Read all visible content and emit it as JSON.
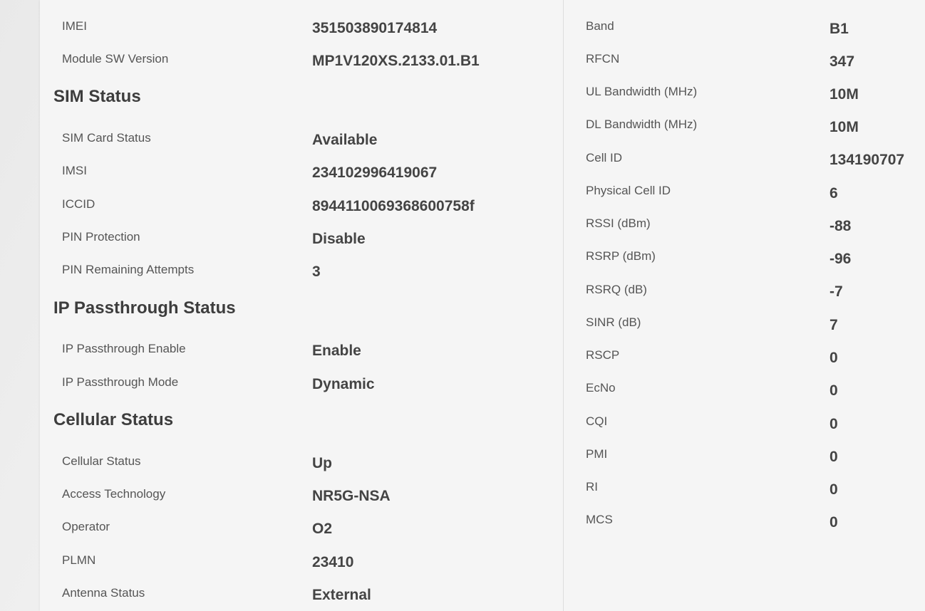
{
  "device": {
    "imei": {
      "label": "IMEI",
      "value": "351503890174814"
    },
    "module_sw": {
      "label": "Module SW Version",
      "value": "MP1V120XS.2133.01.B1"
    }
  },
  "sim_status": {
    "heading": "SIM Status",
    "rows": [
      {
        "label": "SIM Card Status",
        "value": "Available"
      },
      {
        "label": "IMSI",
        "value": "234102996419067"
      },
      {
        "label": "ICCID",
        "value": "8944110069368600758f"
      },
      {
        "label": "PIN Protection",
        "value": "Disable"
      },
      {
        "label": "PIN Remaining Attempts",
        "value": "3"
      }
    ]
  },
  "ip_passthrough": {
    "heading": "IP Passthrough Status",
    "rows": [
      {
        "label": "IP Passthrough Enable",
        "value": "Enable"
      },
      {
        "label": "IP Passthrough Mode",
        "value": "Dynamic"
      }
    ]
  },
  "cellular_status": {
    "heading": "Cellular Status",
    "rows": [
      {
        "label": "Cellular Status",
        "value": "Up"
      },
      {
        "label": "Access Technology",
        "value": "NR5G-NSA"
      },
      {
        "label": "Operator",
        "value": "O2"
      },
      {
        "label": "PLMN",
        "value": "23410"
      },
      {
        "label": "Antenna Status",
        "value": "External"
      }
    ]
  },
  "radio": {
    "rows": [
      {
        "label": "Band",
        "value": "B1"
      },
      {
        "label": "RFCN",
        "value": "347"
      },
      {
        "label": "UL Bandwidth (MHz)",
        "value": "10M"
      },
      {
        "label": "DL Bandwidth (MHz)",
        "value": "10M"
      },
      {
        "label": "Cell ID",
        "value": "134190707"
      },
      {
        "label": "Physical Cell ID",
        "value": "6"
      },
      {
        "label": "RSSI (dBm)",
        "value": "-88"
      },
      {
        "label": "RSRP (dBm)",
        "value": "-96"
      },
      {
        "label": "RSRQ (dB)",
        "value": "-7"
      },
      {
        "label": "SINR (dB)",
        "value": "7"
      },
      {
        "label": "RSCP",
        "value": "0"
      },
      {
        "label": "EcNo",
        "value": "0"
      },
      {
        "label": "CQI",
        "value": "0"
      },
      {
        "label": "PMI",
        "value": "0"
      },
      {
        "label": "RI",
        "value": "0"
      },
      {
        "label": "MCS",
        "value": "0"
      }
    ]
  }
}
